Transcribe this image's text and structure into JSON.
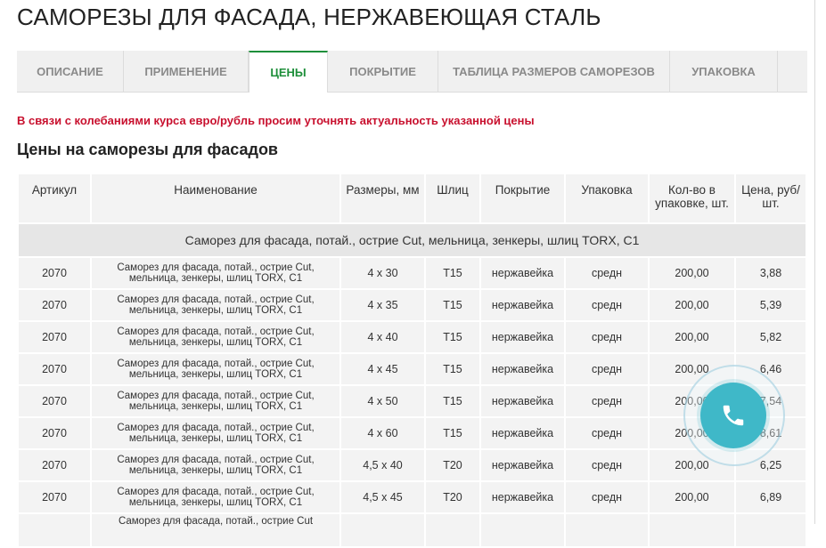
{
  "page": {
    "title": "САМОРЕЗЫ ДЛЯ ФАСАДА, НЕРЖАВЕЮЩАЯ СТАЛЬ"
  },
  "tabs": [
    {
      "label": "ОПИСАНИЕ",
      "active": false
    },
    {
      "label": "ПРИМЕНЕНИЕ",
      "active": false
    },
    {
      "label": "ЦЕНЫ",
      "active": true
    },
    {
      "label": "ПОКРЫТИЕ",
      "active": false
    },
    {
      "label": "ТАБЛИЦА РАЗМЕРОВ САМОРЕЗОВ",
      "active": false
    },
    {
      "label": "УПАКОВКА",
      "active": false
    }
  ],
  "notice": "В связи с колебаниями курса евро/рубль просим уточнять актуальность указанной  цены",
  "section_title": "Цены на саморезы для фасадов",
  "table": {
    "headers": {
      "article": "Артикул",
      "name": "Наименование",
      "size": "Размеры, мм",
      "slot": "Шлиц",
      "coating": "Покрытие",
      "packing": "Упаковка",
      "qty": "Кол-во в упаковке, шт.",
      "price": "Цена, руб/шт."
    },
    "group_label": "Саморез для фасада, потай., острие Cut, мельница, зенкеры, шлиц TORX, C1",
    "rows": [
      {
        "article": "2070",
        "name": "Саморез для фасада, потай., острие Cut, мельница, зенкеры, шлиц TORX, C1",
        "size": "4 х 30",
        "slot": "T15",
        "coating": "нержавейка",
        "packing": "средн",
        "qty": "200,00",
        "price": "3,88"
      },
      {
        "article": "2070",
        "name": "Саморез для фасада, потай., острие Cut, мельница, зенкеры, шлиц TORX, C1",
        "size": "4 х 35",
        "slot": "T15",
        "coating": "нержавейка",
        "packing": "средн",
        "qty": "200,00",
        "price": "5,39"
      },
      {
        "article": "2070",
        "name": "Саморез для фасада, потай., острие Cut, мельница, зенкеры, шлиц TORX, C1",
        "size": "4 х 40",
        "slot": "T15",
        "coating": "нержавейка",
        "packing": "средн",
        "qty": "200,00",
        "price": "5,82"
      },
      {
        "article": "2070",
        "name": "Саморез для фасада, потай., острие Cut, мельница, зенкеры, шлиц TORX, C1",
        "size": "4 х 45",
        "slot": "T15",
        "coating": "нержавейка",
        "packing": "средн",
        "qty": "200,00",
        "price": "6,46"
      },
      {
        "article": "2070",
        "name": "Саморез для фасада, потай., острие Cut, мельница, зенкеры, шлиц TORX, C1",
        "size": "4 х 50",
        "slot": "T15",
        "coating": "нержавейка",
        "packing": "средн",
        "qty": "200,00",
        "price": "7,54"
      },
      {
        "article": "2070",
        "name": "Саморез для фасада, потай., острие Cut, мельница, зенкеры, шлиц TORX, C1",
        "size": "4 х 60",
        "slot": "T15",
        "coating": "нержавейка",
        "packing": "средн",
        "qty": "200,00",
        "price": "8,61"
      },
      {
        "article": "2070",
        "name": "Саморез для фасада, потай., острие Cut, мельница, зенкеры, шлиц TORX, C1",
        "size": "4,5 х 40",
        "slot": "T20",
        "coating": "нержавейка",
        "packing": "средн",
        "qty": "200,00",
        "price": "6,25"
      },
      {
        "article": "2070",
        "name": "Саморез для фасада, потай., острие Cut, мельница, зенкеры, шлиц TORX, C1",
        "size": "4,5 х 45",
        "slot": "T20",
        "coating": "нержавейка",
        "packing": "средн",
        "qty": "200,00",
        "price": "6,89"
      }
    ],
    "partial_row_name": "Саморез для фасада, потай., острие Cut"
  },
  "call_button": {
    "icon": "phone-icon",
    "color": "#3fb8c8"
  },
  "colors": {
    "accent": "#1e8f3a",
    "notice": "#c8102e"
  }
}
